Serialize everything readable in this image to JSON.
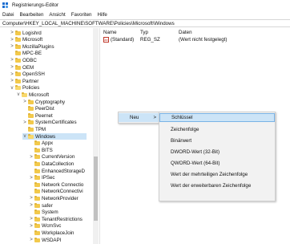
{
  "window": {
    "title": "Registrierungs-Editor"
  },
  "menu": [
    "Datei",
    "Bearbeiten",
    "Ansicht",
    "Favoriten",
    "Hilfe"
  ],
  "address": "Computer\\HKEY_LOCAL_MACHINE\\SOFTWARE\\Policies\\Microsoft\\Windows",
  "tree": [
    {
      "label": "Logishrd",
      "level": 1,
      "chevron": ">"
    },
    {
      "label": "Microsoft",
      "level": 1,
      "chevron": ">"
    },
    {
      "label": "MozillaPlugins",
      "level": 1,
      "chevron": ">"
    },
    {
      "label": "MPC-BE",
      "level": 1,
      "chevron": ""
    },
    {
      "label": "ODBC",
      "level": 1,
      "chevron": ">"
    },
    {
      "label": "OEM",
      "level": 1,
      "chevron": ">"
    },
    {
      "label": "OpenSSH",
      "level": 1,
      "chevron": ">"
    },
    {
      "label": "Partner",
      "level": 1,
      "chevron": ">"
    },
    {
      "label": "Policies",
      "level": 1,
      "chevron": "v"
    },
    {
      "label": "Microsoft",
      "level": 2,
      "chevron": "v"
    },
    {
      "label": "Cryptography",
      "level": 3,
      "chevron": ">"
    },
    {
      "label": "PeerDist",
      "level": 3,
      "chevron": ""
    },
    {
      "label": "Peernet",
      "level": 3,
      "chevron": ""
    },
    {
      "label": "SystemCertificates",
      "level": 3,
      "chevron": ">"
    },
    {
      "label": "TPM",
      "level": 3,
      "chevron": ""
    },
    {
      "label": "Windows",
      "level": 3,
      "chevron": "v",
      "selected": true
    },
    {
      "label": "Appx",
      "level": 4,
      "chevron": ""
    },
    {
      "label": "BITS",
      "level": 4,
      "chevron": ""
    },
    {
      "label": "CurrentVersion",
      "level": 4,
      "chevron": ">"
    },
    {
      "label": "DataCollection",
      "level": 4,
      "chevron": ""
    },
    {
      "label": "EnhancedStorageD",
      "level": 4,
      "chevron": ""
    },
    {
      "label": "IPSec",
      "level": 4,
      "chevron": ">"
    },
    {
      "label": "Network Connectio",
      "level": 4,
      "chevron": ""
    },
    {
      "label": "NetworkConnectivi",
      "level": 4,
      "chevron": ""
    },
    {
      "label": "NetworkProvider",
      "level": 4,
      "chevron": ">"
    },
    {
      "label": "safer",
      "level": 4,
      "chevron": ">"
    },
    {
      "label": "System",
      "level": 4,
      "chevron": ""
    },
    {
      "label": "TenantRestrictions",
      "level": 4,
      "chevron": ">"
    },
    {
      "label": "WcmSvc",
      "level": 4,
      "chevron": ">"
    },
    {
      "label": "WorkplaceJoin",
      "level": 4,
      "chevron": ""
    },
    {
      "label": "WSDAPI",
      "level": 4,
      "chevron": ">"
    }
  ],
  "list": {
    "headers": [
      "Name",
      "Typ",
      "Daten"
    ],
    "rows": [
      {
        "icon": "ab",
        "name": "(Standard)",
        "type": "REG_SZ",
        "data": "(Wert nicht festgelegt)"
      }
    ]
  },
  "context_menu": {
    "main": {
      "label": "Neu",
      "arrow": ">"
    },
    "submenu": [
      "Schlüssel",
      "Zeichenfolge",
      "Binärwert",
      "DWORD-Wert (32-Bit)",
      "QWORD-Wert (64-Bit)",
      "Wert der mehrteiligen Zeichenfolge",
      "Wert der erweiterbaren Zeichenfolge"
    ]
  }
}
